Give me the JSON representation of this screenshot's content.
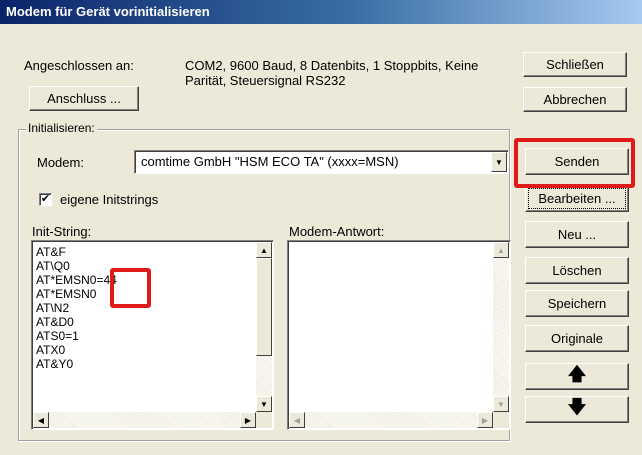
{
  "window": {
    "title": "Modem für Gerät vorinitialisieren"
  },
  "connection": {
    "label": "Angeschlossen an:",
    "line1": "COM2, 9600 Baud, 8 Datenbits, 1 Stoppbits, Keine",
    "line2": "Parität, Steuersignal RS232",
    "port_button": "Anschluss ..."
  },
  "buttons": {
    "close": "Schließen",
    "cancel": "Abbrechen",
    "send": "Senden",
    "edit": "Bearbeiten ...",
    "new": "Neu ...",
    "delete": "Löschen",
    "save": "Speichern",
    "originals": "Originale",
    "up_icon": "arrow-up-icon",
    "down_icon": "arrow-down-icon"
  },
  "init_group": {
    "title": "Initialisieren:",
    "modem_label": "Modem:",
    "modem_value": "comtime GmbH \"HSM ECO TA\" (xxxx=MSN)",
    "own_strings_label": "eigene Initstrings",
    "own_strings_checked": "✔",
    "init_string_label": "Init-String:",
    "modem_answer_label": "Modem-Antwort:",
    "init_lines": [
      "AT&F",
      "AT\\Q0",
      "AT*EMSN0=44",
      "AT*EMSN0",
      "AT\\N2",
      "AT&D0",
      "ATS0=1",
      "ATX0",
      "AT&Y0"
    ]
  },
  "colors": {
    "highlight": "#e0191b",
    "title_start": "#0a246a",
    "face": "#ece9d8"
  }
}
